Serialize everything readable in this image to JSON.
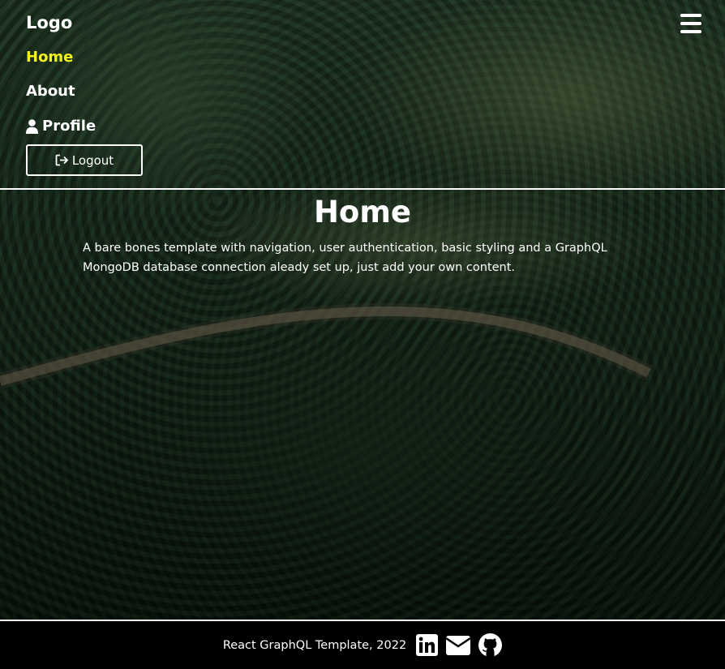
{
  "nav": {
    "logo": "Logo",
    "links": [
      {
        "label": "Home",
        "active": true
      },
      {
        "label": "About",
        "active": false
      },
      {
        "label": "Profile",
        "active": false,
        "icon": "user-icon"
      }
    ],
    "logout": {
      "label": "Logout",
      "icon": "sign-out-icon"
    },
    "menu_icon": "hamburger-menu-icon"
  },
  "main": {
    "title": "Home",
    "description": "A bare bones template with navigation, user authentication, basic styling and a GraphQL MongoDB database connection aleady set up, just add your own content."
  },
  "footer": {
    "text": "React GraphQL Template, 2022",
    "icons": [
      "linkedin-icon",
      "envelope-icon",
      "github-icon"
    ]
  },
  "colors": {
    "active_link": "#f3f31f",
    "text": "#ffffff",
    "footer_bg": "#000000"
  }
}
